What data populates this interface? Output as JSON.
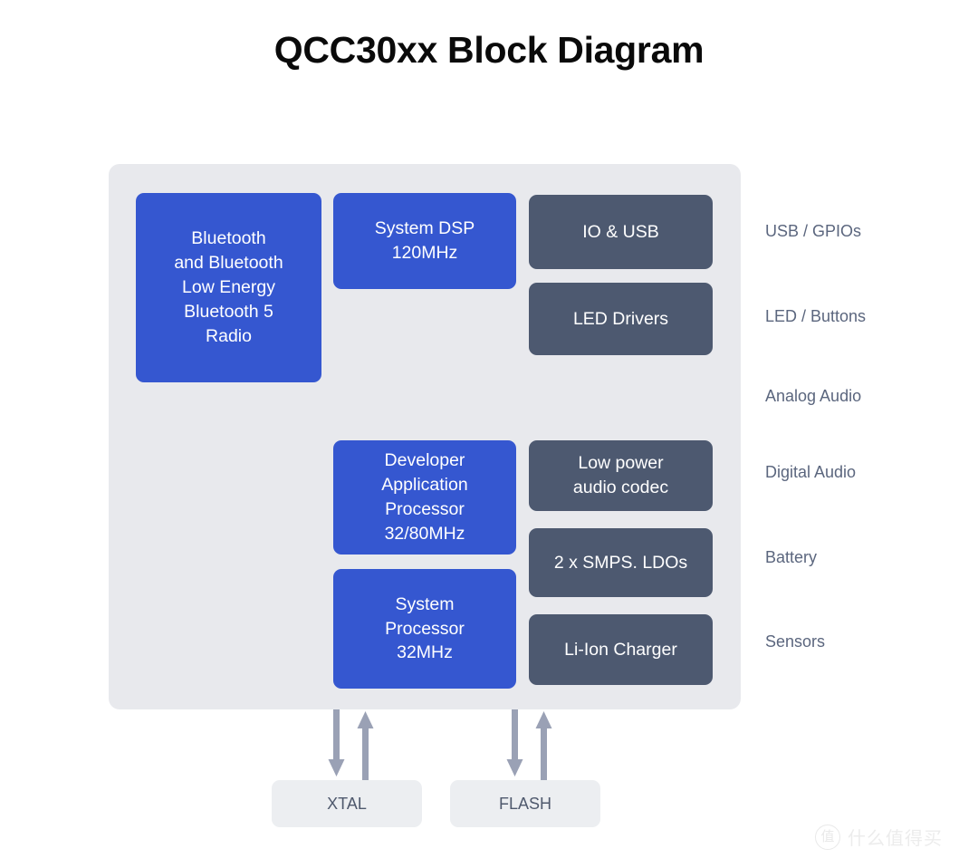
{
  "page": {
    "title": "QCC30xx Block Diagram",
    "background_color": "#ffffff"
  },
  "colors": {
    "blue_block": "#3557d0",
    "slate_block": "#4d5970",
    "panel_background": "#e8e9ed",
    "peripheral_block": "#eceef1",
    "side_label_text": "#5b667e",
    "arrow": "#9aa1b5",
    "title_text": "#0a0a0a"
  },
  "diagram": {
    "panel_name": "QCC30xx SoC",
    "blue_blocks": [
      {
        "name": "bluetooth-radio",
        "lines": [
          "Bluetooth",
          "and Bluetooth",
          "Low Energy",
          "Bluetooth 5",
          "Radio"
        ]
      },
      {
        "name": "system-dsp",
        "lines": [
          "System DSP",
          "120MHz"
        ]
      },
      {
        "name": "developer-application-processor",
        "lines": [
          "Developer",
          "Application",
          "Processor",
          "32/80MHz"
        ]
      },
      {
        "name": "system-processor",
        "lines": [
          "System",
          "Processor",
          "32MHz"
        ]
      }
    ],
    "slate_blocks": [
      {
        "name": "io-and-usb",
        "lines": [
          "IO & USB"
        ]
      },
      {
        "name": "led-drivers",
        "lines": [
          "LED Drivers"
        ]
      },
      {
        "name": "low-power-audio-codec",
        "lines": [
          "Low power",
          "audio codec"
        ]
      },
      {
        "name": "smps-ldos",
        "lines": [
          "2 x SMPS. LDOs"
        ]
      },
      {
        "name": "li-ion-charger",
        "lines": [
          "Li-Ion Charger"
        ]
      }
    ],
    "side_labels": [
      "USB / GPIOs",
      "LED / Buttons",
      "Analog Audio",
      "Digital Audio",
      "Battery",
      "Sensors"
    ],
    "peripherals": [
      {
        "name": "xtal",
        "label": "XTAL"
      },
      {
        "name": "flash",
        "label": "FLASH"
      }
    ]
  },
  "watermark": {
    "logo_glyph": "值",
    "text": "什么值得买"
  }
}
